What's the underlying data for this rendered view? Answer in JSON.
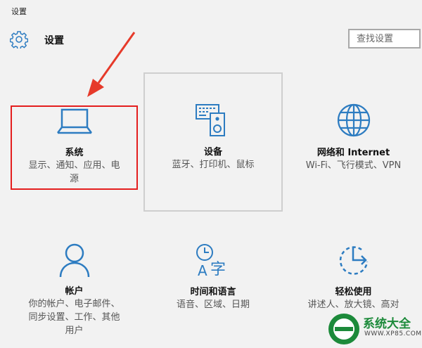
{
  "window": {
    "title": "设置"
  },
  "header": {
    "title": "设置",
    "icon": "gear-icon"
  },
  "search": {
    "placeholder": "查找设置"
  },
  "colors": {
    "accent": "#2d7cc1",
    "selection": "#e41e1e",
    "annotation_arrow": "#e63a2a",
    "watermark": "#1c8a3a"
  },
  "tiles": [
    {
      "id": "system",
      "icon": "laptop-icon",
      "name": "系统",
      "desc_line1": "显示、通知、应用、电",
      "desc_line2": "源"
    },
    {
      "id": "devices",
      "icon": "devices-icon",
      "name": "设备",
      "desc_line1": "蓝牙、打印机、鼠标"
    },
    {
      "id": "network",
      "icon": "globe-icon",
      "name": "网络和 Internet",
      "desc_line1": "Wi-Fi、飞行模式、VPN"
    },
    {
      "id": "accounts",
      "icon": "person-icon",
      "name": "帐户",
      "desc_line1": "你的帐户、电子邮件、",
      "desc_line2": "同步设置、工作、其他",
      "desc_line3": "用户"
    },
    {
      "id": "time",
      "icon": "time-language-icon",
      "name": "时间和语言",
      "desc_line1": "语音、区域、日期"
    },
    {
      "id": "ease",
      "icon": "ease-of-access-icon",
      "name": "轻松使用",
      "desc_line1": "讲述人、放大镜、高对"
    }
  ],
  "watermark": {
    "text": "系统大全",
    "url": "WWW.XP85.COM"
  }
}
